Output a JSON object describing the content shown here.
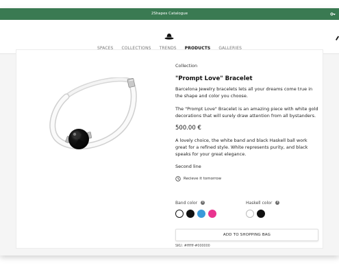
{
  "window": {
    "title": "2Shapes Catalogue"
  },
  "header": {
    "logo_icon": "bowler-hat-logo",
    "nav": [
      {
        "label": "SPACES",
        "active": false
      },
      {
        "label": "COLLECTIONS",
        "active": false
      },
      {
        "label": "TRENDS",
        "active": false
      },
      {
        "label": "PRODUCTS",
        "active": true
      },
      {
        "label": "GALLERIES",
        "active": false
      }
    ]
  },
  "product": {
    "collection": "Collection",
    "title": "\"Prompt Love\" Bracelet",
    "description_1": "Barcelona Jewelry bracelets lets all your dreams come true in the shape and color you choose.",
    "description_2": "The \"Prompt Love\" Bracelet is an amazing piece with white gold decorations that will surely draw attention from all bystanders.",
    "price": "500.00 €",
    "long_description": "A lovely choice, the white band and black Haskell ball work great for a refined style. White represents purity, and black speaks for your great elegance.",
    "second_line": "Second line",
    "delivery": "Recieve it tomorrow",
    "band_color_label": "Band color",
    "band_colors": [
      "#ffffff",
      "#111111",
      "#3a9ad9",
      "#e9348f"
    ],
    "band_selected_index": 0,
    "haskell_color_label": "Haskell color",
    "haskell_colors": [
      "#ffffff",
      "#111111"
    ],
    "haskell_selected_index": 1,
    "add_button": "ADD TO SHOPPING BAG",
    "sku": "SKU: #ffffff-#000000"
  },
  "colors": {
    "titlebar": "#3a7a52",
    "accent_blue": "#3a9ad9",
    "accent_pink": "#e9348f"
  }
}
